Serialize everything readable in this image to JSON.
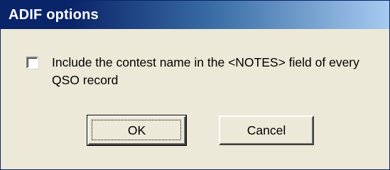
{
  "dialog": {
    "title": "ADIF options",
    "checkbox": {
      "label": "Include the contest name in the <NOTES> field of every QSO record",
      "checked": false
    },
    "buttons": {
      "ok": "OK",
      "cancel": "Cancel"
    }
  }
}
